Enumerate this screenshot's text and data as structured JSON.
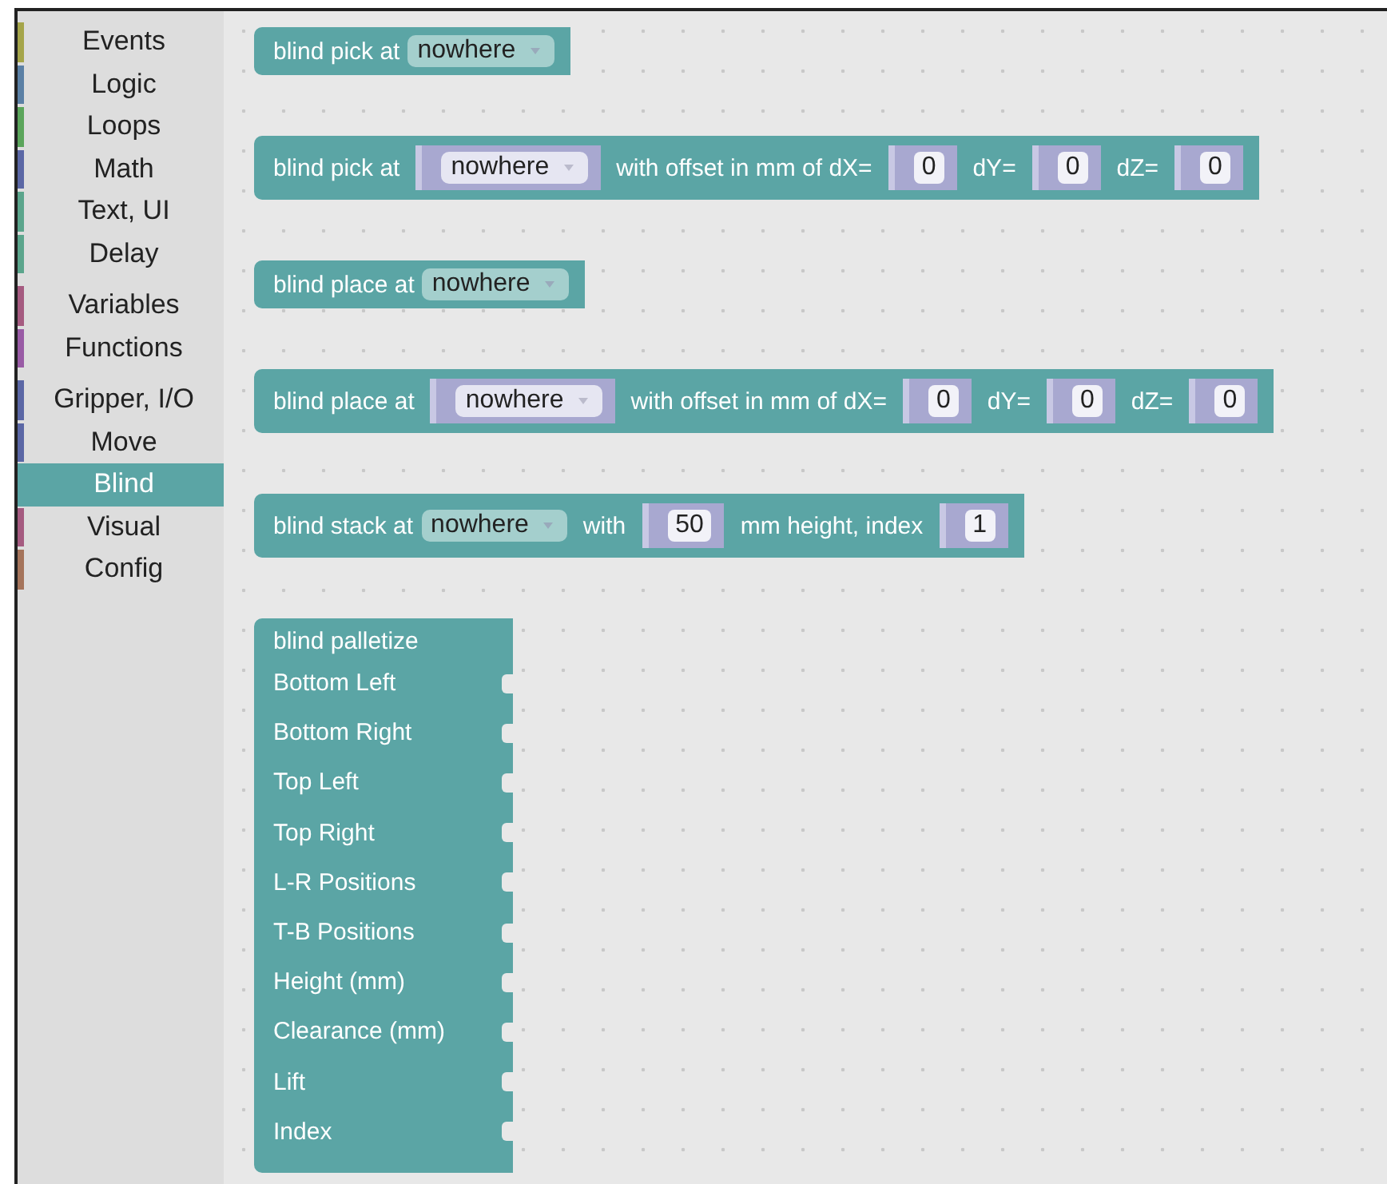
{
  "toolbox": {
    "groups": [
      [
        {
          "label": "Events",
          "color": "#a5a54a",
          "selected": false
        },
        {
          "label": "Logic",
          "color": "#5b80a5",
          "selected": false
        },
        {
          "label": "Loops",
          "color": "#5ba55b",
          "selected": false
        },
        {
          "label": "Math",
          "color": "#5b67a5",
          "selected": false
        },
        {
          "label": "Text, UI",
          "color": "#5ba58c",
          "selected": false
        },
        {
          "label": "Delay",
          "color": "#5ba58c",
          "selected": false
        }
      ],
      [
        {
          "label": "Variables",
          "color": "#a55b80",
          "selected": false
        },
        {
          "label": "Functions",
          "color": "#995ba5",
          "selected": false
        }
      ],
      [
        {
          "label": "Gripper, I/O",
          "color": "#5b67a5",
          "selected": false
        },
        {
          "label": "Move",
          "color": "#5b67a5",
          "selected": false
        },
        {
          "label": "Blind",
          "color": "#5ba5a5",
          "selected": true
        },
        {
          "label": "Visual",
          "color": "#a55b80",
          "selected": false
        },
        {
          "label": "Config",
          "color": "#a5745b",
          "selected": false
        }
      ]
    ]
  },
  "blocks": [
    {
      "kind": "inline",
      "items": [
        {
          "kind": "label",
          "text": "blind pick at"
        },
        {
          "kind": "dropdown",
          "text": "nowhere"
        }
      ]
    },
    {
      "kind": "inline",
      "items": [
        {
          "kind": "label",
          "text": "blind pick at"
        },
        {
          "kind": "dropdown_input",
          "text": "nowhere"
        },
        {
          "kind": "label",
          "text": "with offset in mm of dX="
        },
        {
          "kind": "number_input",
          "text": "0"
        },
        {
          "kind": "label",
          "text": "dY="
        },
        {
          "kind": "number_input",
          "text": "0"
        },
        {
          "kind": "label",
          "text": "dZ="
        },
        {
          "kind": "number_input",
          "text": "0"
        }
      ]
    },
    {
      "kind": "inline",
      "items": [
        {
          "kind": "label",
          "text": "blind place at"
        },
        {
          "kind": "dropdown",
          "text": "nowhere"
        }
      ]
    },
    {
      "kind": "inline",
      "items": [
        {
          "kind": "label",
          "text": "blind place at"
        },
        {
          "kind": "dropdown_input",
          "text": "nowhere"
        },
        {
          "kind": "label",
          "text": "with offset in mm of dX="
        },
        {
          "kind": "number_input",
          "text": "0"
        },
        {
          "kind": "label",
          "text": "dY="
        },
        {
          "kind": "number_input",
          "text": "0"
        },
        {
          "kind": "label",
          "text": "dZ="
        },
        {
          "kind": "number_input",
          "text": "0"
        }
      ]
    },
    {
      "kind": "inline",
      "items": [
        {
          "kind": "label",
          "text": "blind stack at"
        },
        {
          "kind": "dropdown",
          "text": "nowhere"
        },
        {
          "kind": "label",
          "text": "with"
        },
        {
          "kind": "number_input",
          "text": "50"
        },
        {
          "kind": "label",
          "text": "mm height, index"
        },
        {
          "kind": "number_input",
          "text": "1"
        }
      ]
    },
    {
      "kind": "external",
      "title": "blind palletize",
      "inputs": [
        "Bottom Left",
        "Bottom Right",
        "Top Left",
        "Top Right",
        "L-R Positions",
        "T-B Positions",
        "Height (mm)",
        "Clearance (mm)",
        "Lift",
        "Index"
      ]
    }
  ]
}
